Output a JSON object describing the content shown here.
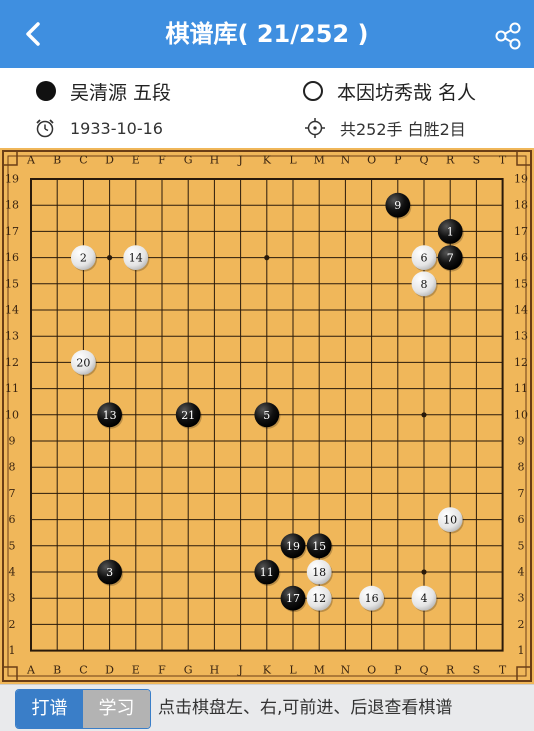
{
  "header": {
    "title": "棋谱库( 21/252 )",
    "back_icon": "chevron-left-icon",
    "share_icon": "share-icon"
  },
  "players": {
    "black": {
      "name": "吴清源 五段"
    },
    "white": {
      "name": "本因坊秀哉 名人"
    }
  },
  "game_info": {
    "date": "1933-10-16",
    "result": "共252手 白胜2目"
  },
  "board": {
    "size": 19,
    "columns": [
      "A",
      "B",
      "C",
      "D",
      "E",
      "F",
      "G",
      "H",
      "J",
      "K",
      "L",
      "M",
      "N",
      "O",
      "P",
      "Q",
      "R",
      "S",
      "T"
    ],
    "rows": [
      "19",
      "18",
      "17",
      "16",
      "15",
      "14",
      "13",
      "12",
      "11",
      "10",
      "9",
      "8",
      "7",
      "6",
      "5",
      "4",
      "3",
      "2",
      "1"
    ],
    "star_points": [
      "D16",
      "K16",
      "Q10",
      "Q4"
    ],
    "stones": [
      {
        "n": "1",
        "color": "black",
        "pos": "R17"
      },
      {
        "n": "2",
        "color": "white",
        "pos": "C16"
      },
      {
        "n": "3",
        "color": "black",
        "pos": "D4"
      },
      {
        "n": "4",
        "color": "white",
        "pos": "Q3"
      },
      {
        "n": "5",
        "color": "black",
        "pos": "K10"
      },
      {
        "n": "6",
        "color": "white",
        "pos": "Q16"
      },
      {
        "n": "7",
        "color": "black",
        "pos": "R16"
      },
      {
        "n": "8",
        "color": "white",
        "pos": "Q15"
      },
      {
        "n": "9",
        "color": "black",
        "pos": "P18"
      },
      {
        "n": "10",
        "color": "white",
        "pos": "R6"
      },
      {
        "n": "11",
        "color": "black",
        "pos": "K4"
      },
      {
        "n": "12",
        "color": "white",
        "pos": "M3"
      },
      {
        "n": "13",
        "color": "black",
        "pos": "D10"
      },
      {
        "n": "14",
        "color": "white",
        "pos": "E16"
      },
      {
        "n": "15",
        "color": "black",
        "pos": "M5"
      },
      {
        "n": "16",
        "color": "white",
        "pos": "O3"
      },
      {
        "n": "17",
        "color": "black",
        "pos": "L3"
      },
      {
        "n": "18",
        "color": "white",
        "pos": "M4"
      },
      {
        "n": "19",
        "color": "black",
        "pos": "L5"
      },
      {
        "n": "20",
        "color": "white",
        "pos": "C12"
      },
      {
        "n": "21",
        "color": "black",
        "pos": "G10"
      }
    ]
  },
  "footer": {
    "mode_play": "打谱",
    "mode_study": "学习",
    "hint": "点击棋盘左、右,可前进、后退查看棋谱"
  },
  "colors": {
    "header_bg": "#3f8fe0",
    "board": "#f0b75a",
    "accent": "#3a7ec8"
  }
}
